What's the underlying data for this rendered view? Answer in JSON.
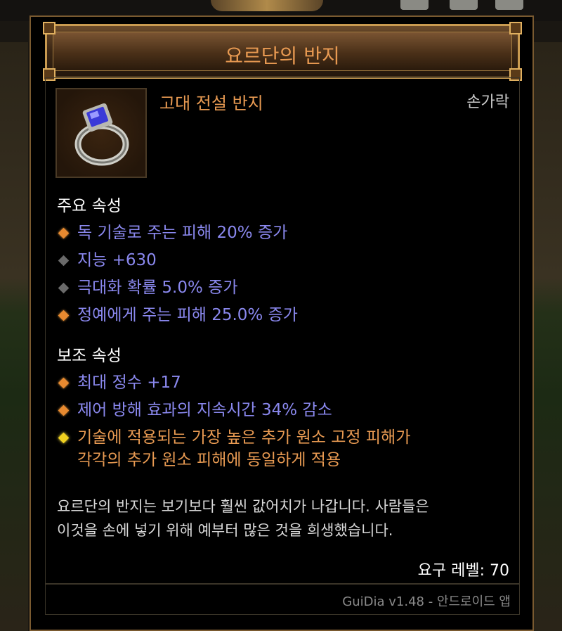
{
  "item": {
    "name": "요르단의 반지",
    "type": "고대 전설 반지",
    "slot": "손가락"
  },
  "primary": {
    "title": "주요 속성",
    "attributes": [
      {
        "text": "독 기술로 주는 피해 20% 증가",
        "bullet": "orange"
      },
      {
        "text": "지능 +630",
        "bullet": "gray"
      },
      {
        "text": "극대화 확률 5.0% 증가",
        "bullet": "gray"
      },
      {
        "text": "정예에게 주는 피해 25.0% 증가",
        "bullet": "orange"
      }
    ]
  },
  "secondary": {
    "title": "보조 속성",
    "attributes": [
      {
        "text": "최대 정수 +17",
        "bullet": "orange"
      },
      {
        "text": "제어 방해 효과의 지속시간 34% 감소",
        "bullet": "orange"
      },
      {
        "line1": "기술에 적용되는 가장 높은 추가 원소 고정 피해가",
        "line2": "각각의 추가 원소 피해에 동일하게 적용",
        "bullet": "yellow"
      }
    ]
  },
  "flavor": {
    "line1": "요르단의 반지는 보기보다 훨씬 값어치가 나갑니다. 사람들은",
    "line2": "이것을 손에 넣기 위해 예부터 많은 것을 희생했습니다."
  },
  "requirement": {
    "label": "요구 레벨:",
    "value": "70"
  },
  "footer": {
    "text": "GuiDia v1.48 - 안드로이드 앱"
  },
  "colors": {
    "legendary": "#e89a52",
    "magic": "#8a88ee",
    "frame": "#c89a50"
  }
}
